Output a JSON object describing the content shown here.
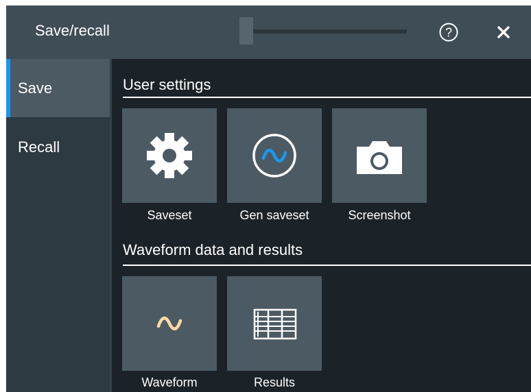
{
  "dialog": {
    "title": "Save/recall",
    "help_symbol": "?",
    "close_symbol": "×"
  },
  "sidebar": {
    "items": [
      {
        "label": "Save",
        "active": true
      },
      {
        "label": "Recall",
        "active": false
      }
    ]
  },
  "sections": {
    "user_settings": {
      "title": "User settings",
      "tiles": [
        {
          "label": "Saveset",
          "icon": "gear-icon"
        },
        {
          "label": "Gen saveset",
          "icon": "generator-wave-icon"
        },
        {
          "label": "Screenshot",
          "icon": "camera-icon"
        }
      ]
    },
    "waveform": {
      "title": "Waveform data and results",
      "tiles": [
        {
          "label": "Waveform",
          "icon": "waveform-icon"
        },
        {
          "label": "Results",
          "icon": "results-table-icon"
        }
      ]
    }
  },
  "colors": {
    "accent_blue": "#1a98f0",
    "waveform_orange": "#ffd9a8",
    "background": "#1c2328",
    "titlebar": "#3f4d57",
    "tile": "#4c5a64"
  }
}
